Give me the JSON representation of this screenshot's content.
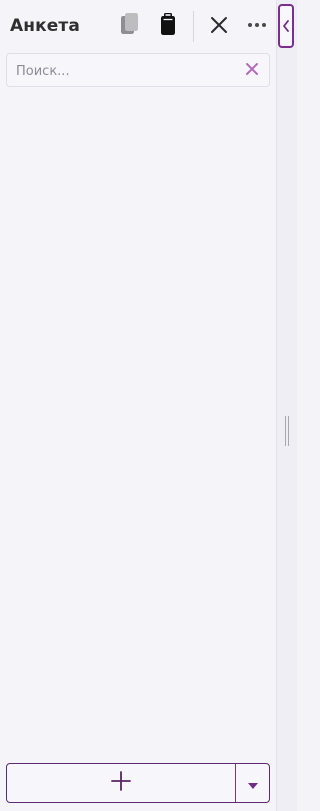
{
  "panel": {
    "title": "Анкета"
  },
  "search": {
    "placeholder": "Поиск...",
    "value": ""
  },
  "toolbar": {
    "icons": [
      "copy-icon",
      "paste-icon",
      "close-icon",
      "more-icon"
    ]
  },
  "actions": {
    "add_icon": "plus-icon",
    "dropdown_icon": "caret-down-icon"
  },
  "colors": {
    "accent": "#6f2d86",
    "accent_soft": "#b56bbd",
    "text_primary": "#2f2f2f",
    "placeholder": "#8b8b95",
    "panel_bg": "#f5f4f9"
  }
}
